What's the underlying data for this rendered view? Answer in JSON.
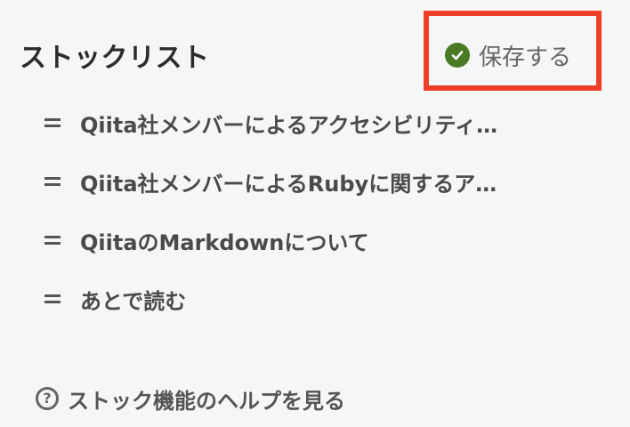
{
  "header": {
    "title": "ストックリスト",
    "save_label": "保存する"
  },
  "stock_lists": [
    {
      "label": "Qiita社メンバーによるアクセシビリティ…"
    },
    {
      "label": "Qiita社メンバーによるRubyに関するア…"
    },
    {
      "label": "QiitaのMarkdownについて"
    },
    {
      "label": "あとで読む"
    }
  ],
  "help": {
    "icon_glyph": "?",
    "label": "ストック機能のヘルプを見る"
  },
  "icons": {
    "save": "check-circle-icon",
    "list_item": "drag-handle-icon",
    "help": "question-circle-icon"
  },
  "colors": {
    "save_check": "#4a7a24",
    "highlight_border": "#ee4028",
    "background": "#f5f6f6"
  }
}
